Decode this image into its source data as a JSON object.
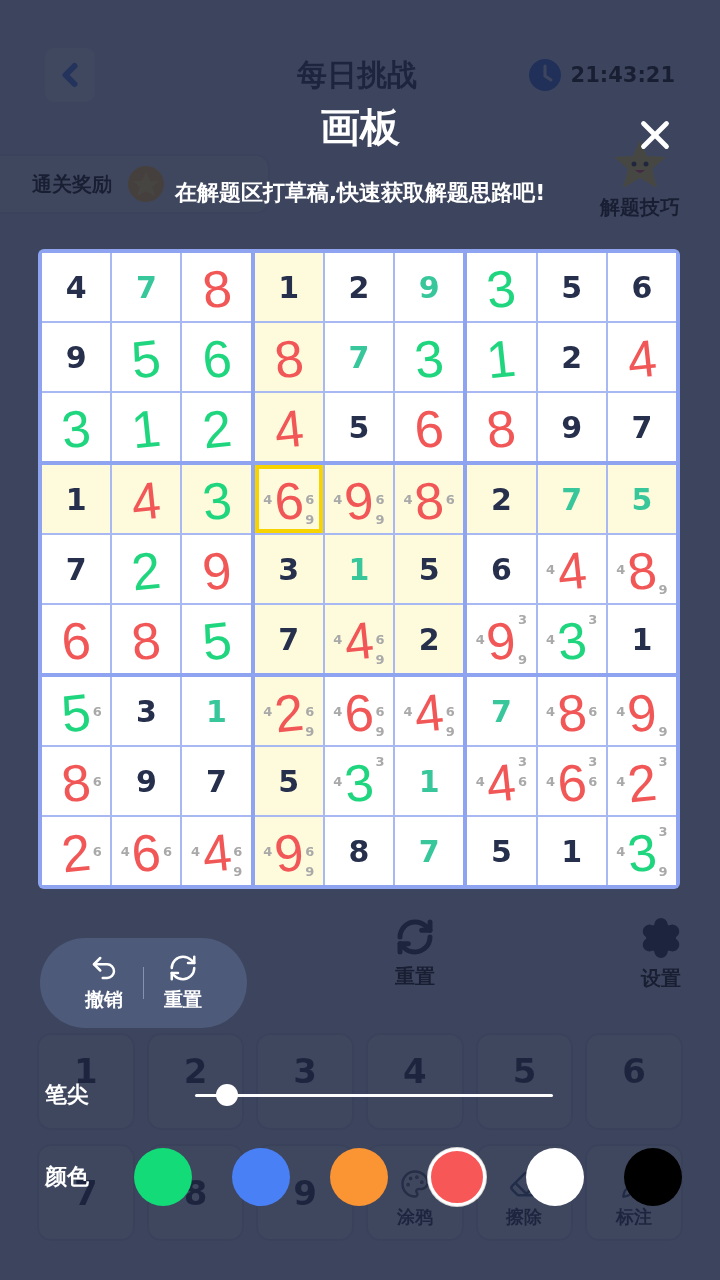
{
  "background": {
    "title": "每日挑战",
    "time": "21:43:21",
    "reward_label": "通关奖励",
    "tips_label": "解题技巧",
    "toolbar": [
      {
        "label": "重置",
        "kind": "reset"
      },
      {
        "label": "设置",
        "kind": "settings"
      }
    ],
    "keypad": [
      {
        "label": "1",
        "kind": "digit"
      },
      {
        "label": "2",
        "kind": "digit"
      },
      {
        "label": "3",
        "kind": "digit"
      },
      {
        "label": "4",
        "kind": "digit"
      },
      {
        "label": "5",
        "kind": "digit"
      },
      {
        "label": "6",
        "kind": "digit"
      },
      {
        "label": "7",
        "kind": "digit"
      },
      {
        "label": "8",
        "kind": "digit"
      },
      {
        "label": "9",
        "kind": "digit"
      },
      {
        "label": "涂鸦",
        "kind": "doodle"
      },
      {
        "label": "擦除",
        "kind": "erase"
      },
      {
        "label": "标注",
        "kind": "note"
      }
    ]
  },
  "board": {
    "rows": [
      {
        "cells": [
          {
            "value": "4",
            "kind": "given",
            "highlighted": false,
            "selected": false
          },
          {
            "value": "7",
            "kind": "entered",
            "highlighted": false,
            "selected": false
          },
          {
            "highlighted": false,
            "selected": false,
            "sketch": {
              "text": "8",
              "color": "#f25757"
            }
          },
          {
            "value": "1",
            "kind": "given",
            "highlighted": true,
            "selected": false
          },
          {
            "value": "2",
            "kind": "given",
            "highlighted": false,
            "selected": false
          },
          {
            "value": "9",
            "kind": "entered",
            "highlighted": false,
            "selected": false
          },
          {
            "highlighted": false,
            "selected": false,
            "sketch": {
              "text": "3",
              "color": "#1fd67f"
            }
          },
          {
            "value": "5",
            "kind": "given",
            "highlighted": false,
            "selected": false
          },
          {
            "value": "6",
            "kind": "given",
            "highlighted": false,
            "selected": false
          }
        ]
      },
      {
        "cells": [
          {
            "value": "9",
            "kind": "given",
            "highlighted": false,
            "selected": false
          },
          {
            "highlighted": false,
            "selected": false,
            "sketch": {
              "text": "5",
              "color": "#1fd67f"
            }
          },
          {
            "highlighted": false,
            "selected": false,
            "sketch": {
              "text": "6",
              "color": "#1fd67f"
            }
          },
          {
            "highlighted": true,
            "selected": false,
            "sketch": {
              "text": "8",
              "color": "#f25757"
            }
          },
          {
            "value": "7",
            "kind": "entered",
            "highlighted": false,
            "selected": false
          },
          {
            "highlighted": false,
            "selected": false,
            "sketch": {
              "text": "3",
              "color": "#1fd67f"
            }
          },
          {
            "highlighted": false,
            "selected": false,
            "sketch": {
              "text": "1",
              "color": "#1fd67f"
            }
          },
          {
            "value": "2",
            "kind": "given",
            "highlighted": false,
            "selected": false
          },
          {
            "highlighted": false,
            "selected": false,
            "sketch": {
              "text": "4",
              "color": "#f25757"
            }
          }
        ]
      },
      {
        "cells": [
          {
            "highlighted": false,
            "selected": false,
            "sketch": {
              "text": "3",
              "color": "#1fd67f"
            }
          },
          {
            "highlighted": false,
            "selected": false,
            "sketch": {
              "text": "1",
              "color": "#1fd67f"
            }
          },
          {
            "highlighted": false,
            "selected": false,
            "sketch": {
              "text": "2",
              "color": "#1fd67f"
            }
          },
          {
            "highlighted": true,
            "selected": false,
            "sketch": {
              "text": "4",
              "color": "#f25757"
            }
          },
          {
            "value": "5",
            "kind": "given",
            "highlighted": false,
            "selected": false
          },
          {
            "highlighted": false,
            "selected": false,
            "sketch": {
              "text": "6",
              "color": "#f25757"
            }
          },
          {
            "highlighted": false,
            "selected": false,
            "sketch": {
              "text": "8",
              "color": "#f25757"
            }
          },
          {
            "value": "9",
            "kind": "given",
            "highlighted": false,
            "selected": false
          },
          {
            "value": "7",
            "kind": "given",
            "highlighted": false,
            "selected": false
          }
        ]
      },
      {
        "cells": [
          {
            "value": "1",
            "kind": "given",
            "highlighted": true,
            "selected": false
          },
          {
            "highlighted": true,
            "selected": false,
            "sketch": {
              "text": "4",
              "color": "#f25757"
            }
          },
          {
            "highlighted": true,
            "selected": false,
            "sketch": {
              "text": "3",
              "color": "#1fd67f"
            }
          },
          {
            "kind": "notes",
            "notes": [
              "4",
              "6",
              "9"
            ],
            "highlighted": true,
            "selected": true,
            "sketch": {
              "text": "6",
              "color": "#f25757"
            }
          },
          {
            "kind": "notes",
            "notes": [
              "4",
              "6",
              "9"
            ],
            "highlighted": true,
            "selected": false,
            "sketch": {
              "text": "9",
              "color": "#f25757"
            }
          },
          {
            "kind": "notes",
            "notes": [
              "4",
              "6"
            ],
            "highlighted": true,
            "selected": false,
            "sketch": {
              "text": "8",
              "color": "#f25757"
            }
          },
          {
            "value": "2",
            "kind": "given",
            "highlighted": true,
            "selected": false
          },
          {
            "value": "7",
            "kind": "entered",
            "highlighted": true,
            "selected": false
          },
          {
            "value": "5",
            "kind": "entered",
            "highlighted": true,
            "selected": false
          }
        ]
      },
      {
        "cells": [
          {
            "value": "7",
            "kind": "given",
            "highlighted": false,
            "selected": false
          },
          {
            "highlighted": false,
            "selected": false,
            "sketch": {
              "text": "2",
              "color": "#1fd67f"
            }
          },
          {
            "highlighted": false,
            "selected": false,
            "sketch": {
              "text": "9",
              "color": "#f25757"
            }
          },
          {
            "value": "3",
            "kind": "given",
            "highlighted": true,
            "selected": false
          },
          {
            "value": "1",
            "kind": "entered",
            "highlighted": true,
            "selected": false
          },
          {
            "value": "5",
            "kind": "given",
            "highlighted": true,
            "selected": false
          },
          {
            "value": "6",
            "kind": "given",
            "highlighted": false,
            "selected": false
          },
          {
            "kind": "notes",
            "notes": [
              "4"
            ],
            "highlighted": false,
            "selected": false,
            "sketch": {
              "text": "4",
              "color": "#f25757"
            }
          },
          {
            "kind": "notes",
            "notes": [
              "4",
              "9"
            ],
            "highlighted": false,
            "selected": false,
            "sketch": {
              "text": "8",
              "color": "#f25757"
            }
          }
        ]
      },
      {
        "cells": [
          {
            "highlighted": false,
            "selected": false,
            "sketch": {
              "text": "6",
              "color": "#f25757"
            }
          },
          {
            "highlighted": false,
            "selected": false,
            "sketch": {
              "text": "8",
              "color": "#f25757"
            }
          },
          {
            "highlighted": false,
            "selected": false,
            "sketch": {
              "text": "5",
              "color": "#1fd67f"
            }
          },
          {
            "value": "7",
            "kind": "given",
            "highlighted": true,
            "selected": false
          },
          {
            "kind": "notes",
            "notes": [
              "4",
              "6",
              "9"
            ],
            "highlighted": true,
            "selected": false,
            "sketch": {
              "text": "4",
              "color": "#f25757"
            }
          },
          {
            "value": "2",
            "kind": "given",
            "highlighted": true,
            "selected": false
          },
          {
            "kind": "notes",
            "notes": [
              "3",
              "4",
              "9"
            ],
            "highlighted": false,
            "selected": false,
            "sketch": {
              "text": "9",
              "color": "#f25757"
            }
          },
          {
            "kind": "notes",
            "notes": [
              "3",
              "4"
            ],
            "highlighted": false,
            "selected": false,
            "sketch": {
              "text": "3",
              "color": "#1fd67f"
            }
          },
          {
            "value": "1",
            "kind": "given",
            "highlighted": false,
            "selected": false
          }
        ]
      },
      {
        "cells": [
          {
            "kind": "notes",
            "notes": [
              "6"
            ],
            "highlighted": false,
            "selected": false,
            "sketch": {
              "text": "5",
              "color": "#1fd67f"
            }
          },
          {
            "value": "3",
            "kind": "given",
            "highlighted": false,
            "selected": false
          },
          {
            "value": "1",
            "kind": "entered",
            "highlighted": false,
            "selected": false
          },
          {
            "kind": "notes",
            "notes": [
              "4",
              "6",
              "9"
            ],
            "highlighted": true,
            "selected": false,
            "sketch": {
              "text": "2",
              "color": "#f25757"
            }
          },
          {
            "kind": "notes",
            "notes": [
              "4",
              "6",
              "9"
            ],
            "highlighted": false,
            "selected": false,
            "sketch": {
              "text": "6",
              "color": "#f25757"
            }
          },
          {
            "kind": "notes",
            "notes": [
              "4",
              "6",
              "9"
            ],
            "highlighted": false,
            "selected": false,
            "sketch": {
              "text": "4",
              "color": "#f25757"
            }
          },
          {
            "value": "7",
            "kind": "entered",
            "highlighted": false,
            "selected": false
          },
          {
            "kind": "notes",
            "notes": [
              "4",
              "6"
            ],
            "highlighted": false,
            "selected": false,
            "sketch": {
              "text": "8",
              "color": "#f25757"
            }
          },
          {
            "kind": "notes",
            "notes": [
              "4",
              "9"
            ],
            "highlighted": false,
            "selected": false,
            "sketch": {
              "text": "9",
              "color": "#f25757"
            }
          }
        ]
      },
      {
        "cells": [
          {
            "kind": "notes",
            "notes": [
              "6"
            ],
            "highlighted": false,
            "selected": false,
            "sketch": {
              "text": "8",
              "color": "#f25757"
            }
          },
          {
            "value": "9",
            "kind": "given",
            "highlighted": false,
            "selected": false
          },
          {
            "value": "7",
            "kind": "given",
            "highlighted": false,
            "selected": false
          },
          {
            "value": "5",
            "kind": "given",
            "highlighted": true,
            "selected": false
          },
          {
            "kind": "notes",
            "notes": [
              "3",
              "4"
            ],
            "highlighted": false,
            "selected": false,
            "sketch": {
              "text": "3",
              "color": "#1fd67f"
            }
          },
          {
            "value": "1",
            "kind": "entered",
            "highlighted": false,
            "selected": false
          },
          {
            "kind": "notes",
            "notes": [
              "3",
              "4",
              "6"
            ],
            "highlighted": false,
            "selected": false,
            "sketch": {
              "text": "4",
              "color": "#f25757"
            }
          },
          {
            "kind": "notes",
            "notes": [
              "3",
              "4",
              "6"
            ],
            "highlighted": false,
            "selected": false,
            "sketch": {
              "text": "6",
              "color": "#f25757"
            }
          },
          {
            "kind": "notes",
            "notes": [
              "3",
              "4"
            ],
            "highlighted": false,
            "selected": false,
            "sketch": {
              "text": "2",
              "color": "#f25757"
            }
          }
        ]
      },
      {
        "cells": [
          {
            "kind": "notes",
            "notes": [
              "6"
            ],
            "highlighted": false,
            "selected": false,
            "sketch": {
              "text": "2",
              "color": "#f25757"
            }
          },
          {
            "kind": "notes",
            "notes": [
              "4",
              "6"
            ],
            "highlighted": false,
            "selected": false,
            "sketch": {
              "text": "6",
              "color": "#f25757"
            }
          },
          {
            "kind": "notes",
            "notes": [
              "4",
              "6",
              "9"
            ],
            "highlighted": false,
            "selected": false,
            "sketch": {
              "text": "4",
              "color": "#f25757"
            }
          },
          {
            "kind": "notes",
            "notes": [
              "4",
              "6",
              "9"
            ],
            "highlighted": true,
            "selected": false,
            "sketch": {
              "text": "9",
              "color": "#f25757"
            }
          },
          {
            "value": "8",
            "kind": "given",
            "highlighted": false,
            "selected": false
          },
          {
            "value": "7",
            "kind": "entered",
            "highlighted": false,
            "selected": false
          },
          {
            "value": "5",
            "kind": "given",
            "highlighted": false,
            "selected": false
          },
          {
            "value": "1",
            "kind": "given",
            "highlighted": false,
            "selected": false
          },
          {
            "kind": "notes",
            "notes": [
              "3",
              "4",
              "9"
            ],
            "highlighted": false,
            "selected": false,
            "sketch": {
              "text": "3",
              "color": "#1fd67f"
            }
          }
        ]
      }
    ]
  },
  "drawing_panel": {
    "title": "画板",
    "hint": "在解题区打草稿,快速获取解题思路吧!",
    "actions": [
      {
        "label": "撤销",
        "kind": "undo"
      },
      {
        "label": "重置",
        "kind": "redo"
      }
    ],
    "pen": {
      "label": "笔尖",
      "level": 0.09
    },
    "colors": {
      "label": "颜色",
      "swatches": [
        {
          "color": "#12db78",
          "selected": false
        },
        {
          "color": "#4a80f5",
          "selected": false
        },
        {
          "color": "#fb9433",
          "selected": false
        },
        {
          "color": "#f85757",
          "selected": true
        },
        {
          "color": "#ffffff",
          "selected": false
        },
        {
          "color": "#000000",
          "selected": false
        }
      ]
    }
  }
}
